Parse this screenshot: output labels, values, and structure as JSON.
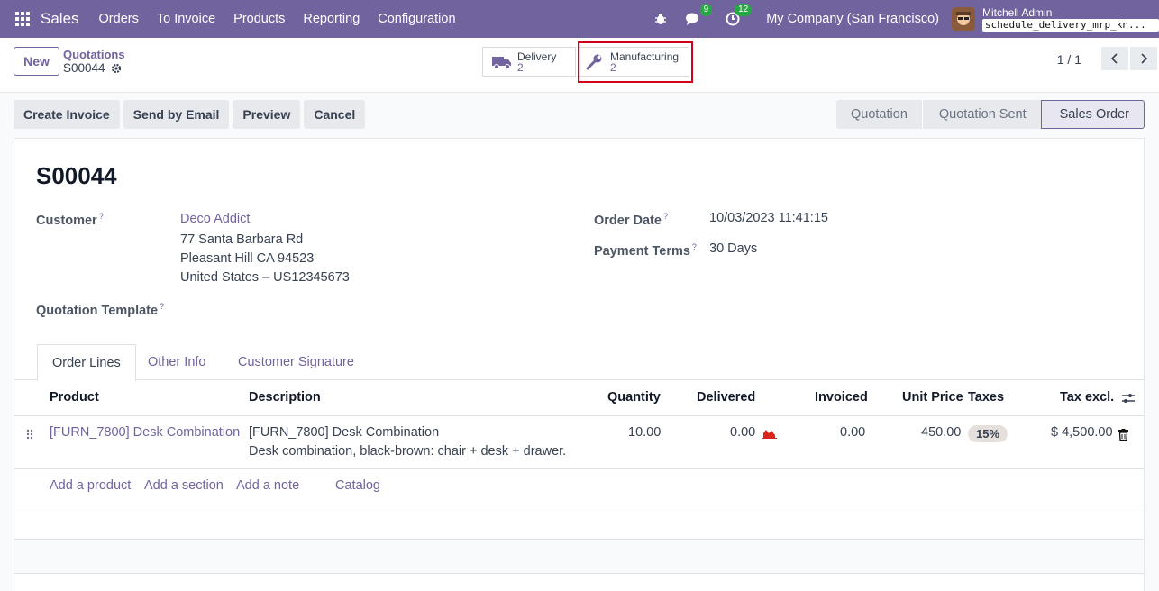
{
  "navbar": {
    "app_name": "Sales",
    "menu": [
      "Orders",
      "To Invoice",
      "Products",
      "Reporting",
      "Configuration"
    ],
    "messages_count": "9",
    "activities_count": "12",
    "company": "My Company (San Francisco)",
    "user_name": "Mitchell Admin",
    "db_name": "schedule_delivery_mrp_kn..."
  },
  "control": {
    "new_label": "New",
    "breadcrumb_parent": "Quotations",
    "breadcrumb_current": "S00044",
    "smart_buttons": [
      {
        "label": "Delivery",
        "value": "2"
      },
      {
        "label": "Manufacturing",
        "value": "2"
      }
    ],
    "pager": "1 / 1"
  },
  "actions": [
    "Create Invoice",
    "Send by Email",
    "Preview",
    "Cancel"
  ],
  "stages": [
    "Quotation",
    "Quotation Sent",
    "Sales Order"
  ],
  "form": {
    "title": "S00044",
    "customer_label": "Customer",
    "customer_name": "Deco Addict",
    "address_line1": "77 Santa Barbara Rd",
    "address_line2": "Pleasant Hill CA 94523",
    "address_line3": "United States – US12345673",
    "template_label": "Quotation Template",
    "order_date_label": "Order Date",
    "order_date": "10/03/2023 11:41:15",
    "payment_terms_label": "Payment Terms",
    "payment_terms": "30 Days"
  },
  "tabs": [
    "Order Lines",
    "Other Info",
    "Customer Signature"
  ],
  "table": {
    "headers": [
      "Product",
      "Description",
      "Quantity",
      "Delivered",
      "Invoiced",
      "Unit Price",
      "Taxes",
      "Tax excl."
    ],
    "rows": [
      {
        "product": "[FURN_7800] Desk Combination",
        "description_line1": "[FURN_7800] Desk Combination",
        "description_line2": "Desk combination, black-brown: chair + desk + drawer.",
        "quantity": "10.00",
        "delivered": "0.00",
        "invoiced": "0.00",
        "unit_price": "450.00",
        "taxes": "15%",
        "subtotal": "$ 4,500.00"
      }
    ],
    "add_links": [
      "Add a product",
      "Add a section",
      "Add a note",
      "Catalog"
    ]
  },
  "colors": {
    "brand": "#71639e",
    "highlight": "#d0021b",
    "badge": "#28a745"
  }
}
